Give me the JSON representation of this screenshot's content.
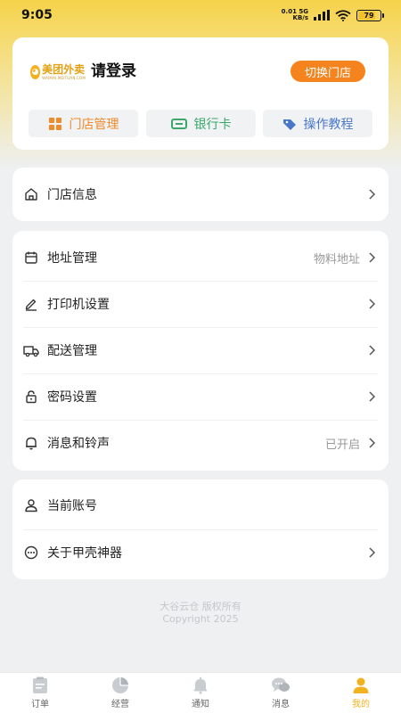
{
  "status_bar": {
    "time": "9:05",
    "net_speed_top": "0.01 5G",
    "net_speed_bottom": "KB/s",
    "battery": "79",
    "battery_level": 0.79
  },
  "profile": {
    "logo_text": "美团外卖",
    "logo_sub": "WAIMAI.MEITUAN.COM",
    "login_label": "请登录",
    "switch_store_label": "切换门店"
  },
  "quick_actions": [
    {
      "label": "门店管理",
      "icon": "grid-icon",
      "color": "#f08a2a"
    },
    {
      "label": "银行卡",
      "icon": "bank-card-icon",
      "color": "#3aa86b"
    },
    {
      "label": "操作教程",
      "icon": "tag-icon",
      "color": "#4a78c8"
    }
  ],
  "menu_store": {
    "label": "门店信息",
    "icon": "home-icon"
  },
  "menu_settings": [
    {
      "label": "地址管理",
      "value": "物料地址",
      "icon": "calendar-icon"
    },
    {
      "label": "打印机设置",
      "value": "",
      "icon": "edit-icon"
    },
    {
      "label": "配送管理",
      "value": "",
      "icon": "truck-icon"
    },
    {
      "label": "密码设置",
      "value": "",
      "icon": "lock-icon"
    },
    {
      "label": "消息和铃声",
      "value": "已开启",
      "icon": "bell-icon"
    }
  ],
  "menu_account": [
    {
      "label": "当前账号",
      "icon": "user-icon",
      "has_arrow": false
    },
    {
      "label": "关于甲壳神器",
      "icon": "more-circle-icon",
      "has_arrow": true
    }
  ],
  "footer": {
    "line1": "大谷云仓 版权所有",
    "line2": "Copyright 2025"
  },
  "tabs": [
    {
      "label": "订单",
      "icon": "order-icon",
      "active": false
    },
    {
      "label": "经营",
      "icon": "pie-chart-icon",
      "active": false
    },
    {
      "label": "通知",
      "icon": "bell-icon",
      "active": false
    },
    {
      "label": "消息",
      "icon": "chat-icon",
      "active": false
    },
    {
      "label": "我的",
      "icon": "profile-icon",
      "active": true
    }
  ],
  "colors": {
    "accent": "#f5841f",
    "active_tab": "#f2b21f",
    "header_yellow": "#f7d34a"
  }
}
